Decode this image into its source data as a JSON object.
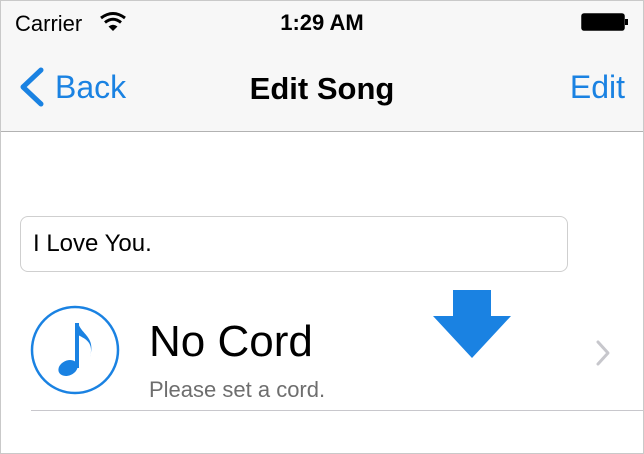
{
  "status_bar": {
    "carrier": "Carrier",
    "time": "1:29 AM"
  },
  "nav": {
    "back_label": "Back",
    "title": "Edit Song",
    "edit_label": "Edit"
  },
  "song": {
    "title_value": "I Love You.",
    "chord_title": "No Cord",
    "chord_subtitle": "Please set a cord."
  },
  "colors": {
    "accent": "#1a82e2",
    "bar_background": "#f7f7f7",
    "secondary_text": "#6e6e6e"
  },
  "icons": [
    "wifi-icon",
    "battery-icon",
    "back-chevron-icon",
    "music-note-icon",
    "down-arrow-icon",
    "chevron-right-icon"
  ]
}
